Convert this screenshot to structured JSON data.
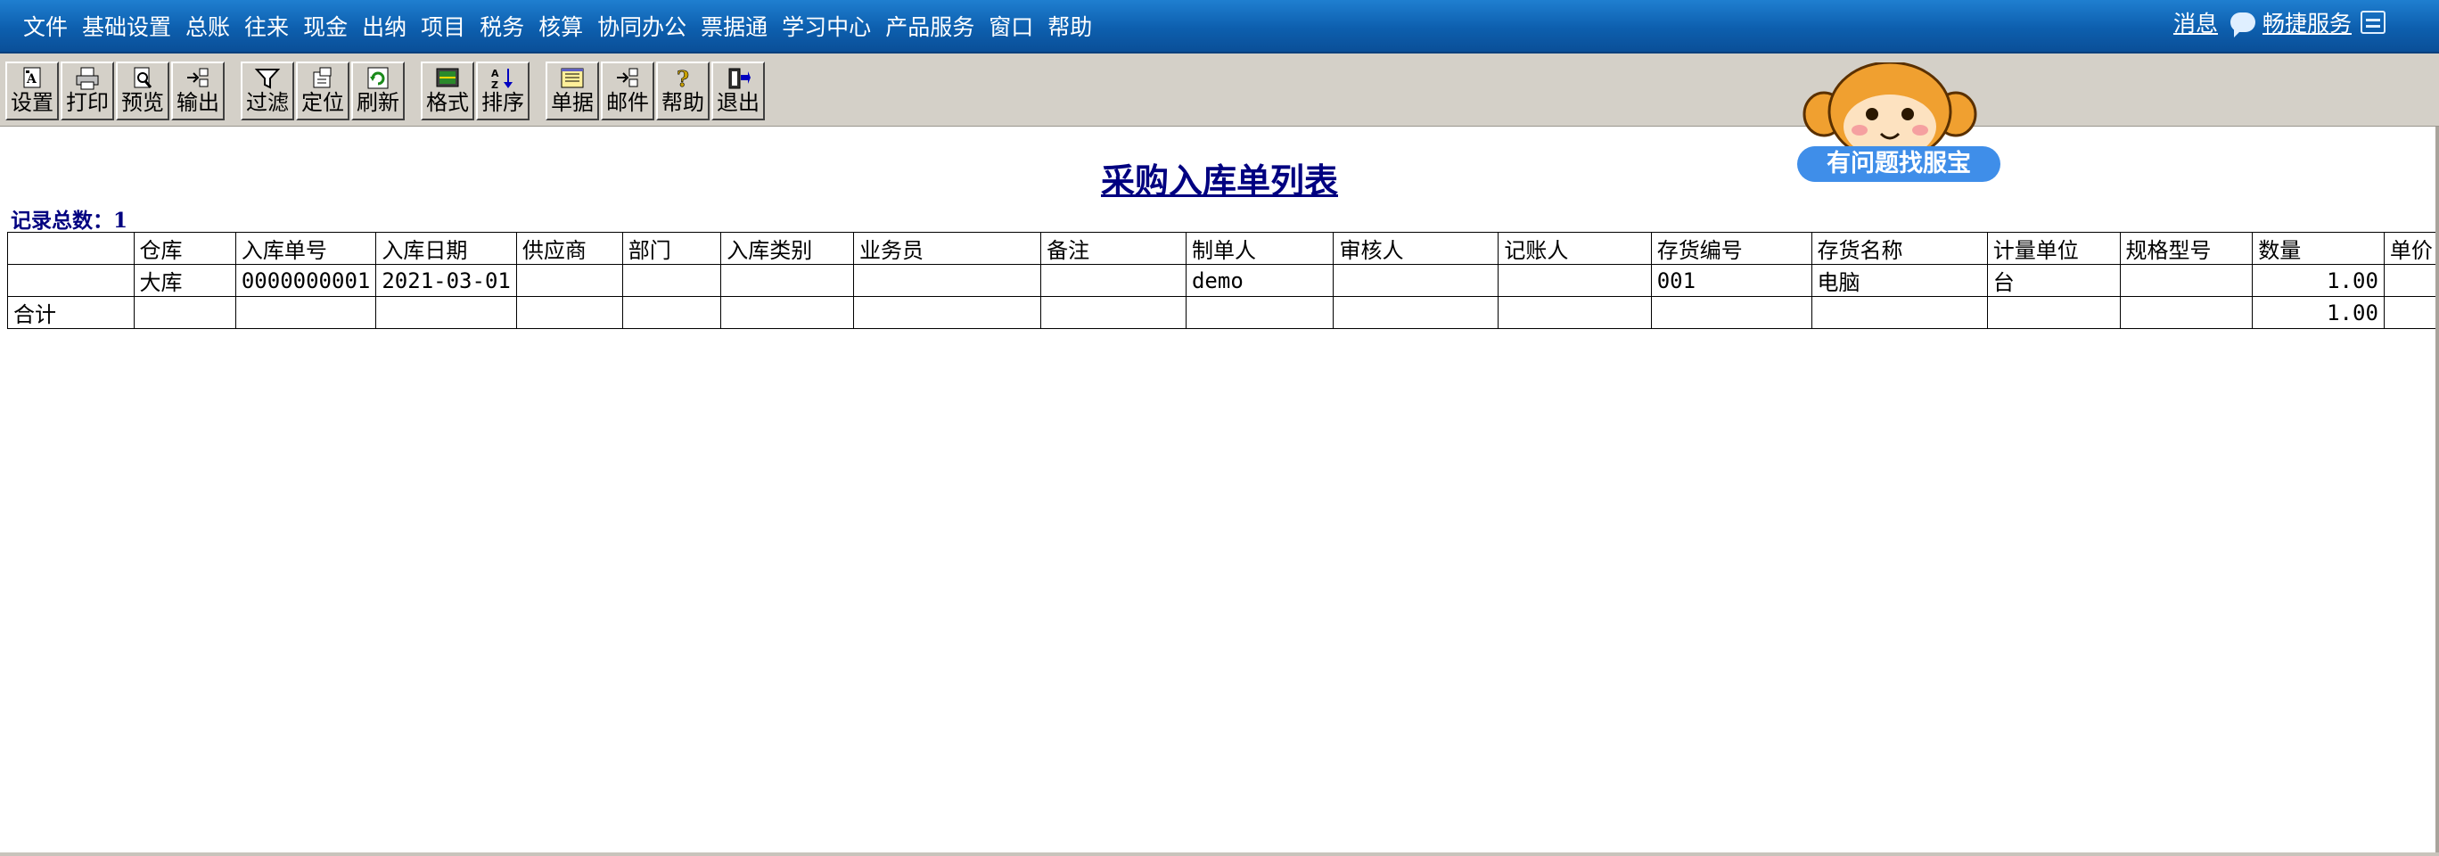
{
  "menu": {
    "items": [
      "文件",
      "基础设置",
      "总账",
      "往来",
      "现金",
      "出纳",
      "项目",
      "税务",
      "核算",
      "协同办公",
      "票据通",
      "学习中心",
      "产品服务",
      "窗口",
      "帮助"
    ],
    "message_label": "消息",
    "service_label": "畅捷服务"
  },
  "toolbar": {
    "buttons": [
      {
        "label": "设置",
        "icon": "settings-icon"
      },
      {
        "label": "打印",
        "icon": "print-icon"
      },
      {
        "label": "预览",
        "icon": "preview-icon"
      },
      {
        "label": "输出",
        "icon": "export-icon"
      },
      {
        "label": "过滤",
        "icon": "filter-icon"
      },
      {
        "label": "定位",
        "icon": "locate-icon"
      },
      {
        "label": "刷新",
        "icon": "refresh-icon"
      },
      {
        "label": "格式",
        "icon": "format-icon"
      },
      {
        "label": "排序",
        "icon": "sort-icon"
      },
      {
        "label": "单据",
        "icon": "document-icon"
      },
      {
        "label": "邮件",
        "icon": "mail-icon"
      },
      {
        "label": "帮助",
        "icon": "help-icon"
      },
      {
        "label": "退出",
        "icon": "exit-icon"
      }
    ]
  },
  "help_badge": "有问题找服宝",
  "report": {
    "title": "采购入库单列表",
    "record_count": "记录总数：1"
  },
  "table": {
    "columns": [
      "",
      "仓库",
      "入库单号",
      "入库日期",
      "供应商",
      "部门",
      "入库类别",
      "业务员",
      "备注",
      "制单人",
      "审核人",
      "记账人",
      "存货编号",
      "存货名称",
      "计量单位",
      "规格型号",
      "数量",
      "单价"
    ],
    "rows": [
      [
        "",
        "大库",
        "0000000001",
        "2021-03-01",
        "",
        "",
        "",
        "",
        "",
        "demo",
        "",
        "",
        "001",
        "电脑",
        "台",
        "",
        "1.00",
        ""
      ],
      [
        "合计",
        "",
        "",
        "",
        "",
        "",
        "",
        "",
        "",
        "",
        "",
        "",
        "",
        "",
        "",
        "",
        "1.00",
        ""
      ]
    ]
  },
  "colors": {
    "menubar": "#0d5fae",
    "title": "#000080",
    "toolbar": "#d4d0c8",
    "badge": "#3f8ee9"
  }
}
